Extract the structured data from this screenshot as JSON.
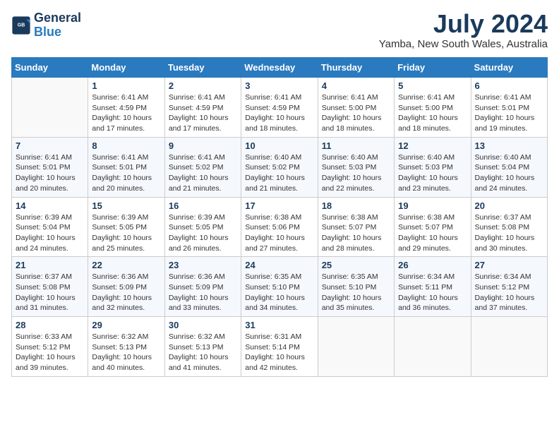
{
  "header": {
    "logo_line1": "General",
    "logo_line2": "Blue",
    "month_year": "July 2024",
    "location": "Yamba, New South Wales, Australia"
  },
  "weekdays": [
    "Sunday",
    "Monday",
    "Tuesday",
    "Wednesday",
    "Thursday",
    "Friday",
    "Saturday"
  ],
  "weeks": [
    [
      {
        "day": "",
        "info": ""
      },
      {
        "day": "1",
        "info": "Sunrise: 6:41 AM\nSunset: 4:59 PM\nDaylight: 10 hours\nand 17 minutes."
      },
      {
        "day": "2",
        "info": "Sunrise: 6:41 AM\nSunset: 4:59 PM\nDaylight: 10 hours\nand 17 minutes."
      },
      {
        "day": "3",
        "info": "Sunrise: 6:41 AM\nSunset: 4:59 PM\nDaylight: 10 hours\nand 18 minutes."
      },
      {
        "day": "4",
        "info": "Sunrise: 6:41 AM\nSunset: 5:00 PM\nDaylight: 10 hours\nand 18 minutes."
      },
      {
        "day": "5",
        "info": "Sunrise: 6:41 AM\nSunset: 5:00 PM\nDaylight: 10 hours\nand 18 minutes."
      },
      {
        "day": "6",
        "info": "Sunrise: 6:41 AM\nSunset: 5:01 PM\nDaylight: 10 hours\nand 19 minutes."
      }
    ],
    [
      {
        "day": "7",
        "info": "Sunrise: 6:41 AM\nSunset: 5:01 PM\nDaylight: 10 hours\nand 20 minutes."
      },
      {
        "day": "8",
        "info": "Sunrise: 6:41 AM\nSunset: 5:01 PM\nDaylight: 10 hours\nand 20 minutes."
      },
      {
        "day": "9",
        "info": "Sunrise: 6:41 AM\nSunset: 5:02 PM\nDaylight: 10 hours\nand 21 minutes."
      },
      {
        "day": "10",
        "info": "Sunrise: 6:40 AM\nSunset: 5:02 PM\nDaylight: 10 hours\nand 21 minutes."
      },
      {
        "day": "11",
        "info": "Sunrise: 6:40 AM\nSunset: 5:03 PM\nDaylight: 10 hours\nand 22 minutes."
      },
      {
        "day": "12",
        "info": "Sunrise: 6:40 AM\nSunset: 5:03 PM\nDaylight: 10 hours\nand 23 minutes."
      },
      {
        "day": "13",
        "info": "Sunrise: 6:40 AM\nSunset: 5:04 PM\nDaylight: 10 hours\nand 24 minutes."
      }
    ],
    [
      {
        "day": "14",
        "info": "Sunrise: 6:39 AM\nSunset: 5:04 PM\nDaylight: 10 hours\nand 24 minutes."
      },
      {
        "day": "15",
        "info": "Sunrise: 6:39 AM\nSunset: 5:05 PM\nDaylight: 10 hours\nand 25 minutes."
      },
      {
        "day": "16",
        "info": "Sunrise: 6:39 AM\nSunset: 5:05 PM\nDaylight: 10 hours\nand 26 minutes."
      },
      {
        "day": "17",
        "info": "Sunrise: 6:38 AM\nSunset: 5:06 PM\nDaylight: 10 hours\nand 27 minutes."
      },
      {
        "day": "18",
        "info": "Sunrise: 6:38 AM\nSunset: 5:07 PM\nDaylight: 10 hours\nand 28 minutes."
      },
      {
        "day": "19",
        "info": "Sunrise: 6:38 AM\nSunset: 5:07 PM\nDaylight: 10 hours\nand 29 minutes."
      },
      {
        "day": "20",
        "info": "Sunrise: 6:37 AM\nSunset: 5:08 PM\nDaylight: 10 hours\nand 30 minutes."
      }
    ],
    [
      {
        "day": "21",
        "info": "Sunrise: 6:37 AM\nSunset: 5:08 PM\nDaylight: 10 hours\nand 31 minutes."
      },
      {
        "day": "22",
        "info": "Sunrise: 6:36 AM\nSunset: 5:09 PM\nDaylight: 10 hours\nand 32 minutes."
      },
      {
        "day": "23",
        "info": "Sunrise: 6:36 AM\nSunset: 5:09 PM\nDaylight: 10 hours\nand 33 minutes."
      },
      {
        "day": "24",
        "info": "Sunrise: 6:35 AM\nSunset: 5:10 PM\nDaylight: 10 hours\nand 34 minutes."
      },
      {
        "day": "25",
        "info": "Sunrise: 6:35 AM\nSunset: 5:10 PM\nDaylight: 10 hours\nand 35 minutes."
      },
      {
        "day": "26",
        "info": "Sunrise: 6:34 AM\nSunset: 5:11 PM\nDaylight: 10 hours\nand 36 minutes."
      },
      {
        "day": "27",
        "info": "Sunrise: 6:34 AM\nSunset: 5:12 PM\nDaylight: 10 hours\nand 37 minutes."
      }
    ],
    [
      {
        "day": "28",
        "info": "Sunrise: 6:33 AM\nSunset: 5:12 PM\nDaylight: 10 hours\nand 39 minutes."
      },
      {
        "day": "29",
        "info": "Sunrise: 6:32 AM\nSunset: 5:13 PM\nDaylight: 10 hours\nand 40 minutes."
      },
      {
        "day": "30",
        "info": "Sunrise: 6:32 AM\nSunset: 5:13 PM\nDaylight: 10 hours\nand 41 minutes."
      },
      {
        "day": "31",
        "info": "Sunrise: 6:31 AM\nSunset: 5:14 PM\nDaylight: 10 hours\nand 42 minutes."
      },
      {
        "day": "",
        "info": ""
      },
      {
        "day": "",
        "info": ""
      },
      {
        "day": "",
        "info": ""
      }
    ]
  ]
}
